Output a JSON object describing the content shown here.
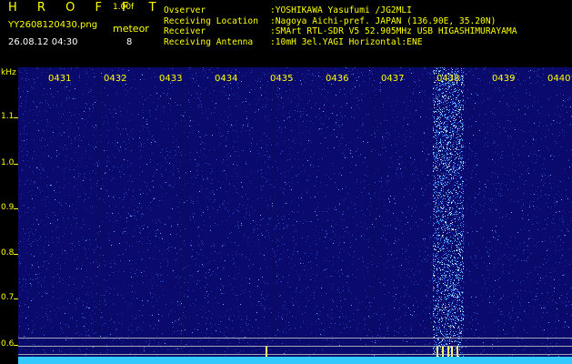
{
  "header": {
    "brand": "H R O F F T",
    "version": "1.00f",
    "filename": "YY2608120430.png",
    "meteor_label": "meteor",
    "datetime": "26.08.12 04:30",
    "meteor_count": "8"
  },
  "info": [
    {
      "label": "Ovserver",
      "value": ":YOSHIKAWA Yasufumi /JG2MLI"
    },
    {
      "label": "Receiving Location",
      "value": ":Nagoya Aichi-pref. JAPAN (136.90E, 35.20N)"
    },
    {
      "label": "Receiver",
      "value": ":SMArt RTL-SDR V5 52.905MHz USB HIGASHIMURAYAMA"
    },
    {
      "label": "Receiving Antenna",
      "value": ":10mH 3el.YAGI Horizontal:ENE"
    }
  ],
  "plot": {
    "y_unit": "kHz",
    "y_ticks": [
      "1.1",
      "1.0",
      "0.9",
      "0.8",
      "0.7",
      "0.6"
    ],
    "x_ticks": [
      "0431",
      "0432",
      "0433",
      "0434",
      "0435",
      "0436",
      "0437",
      "0438",
      "0439",
      "0440"
    ],
    "colors": {
      "label": "#ffff00",
      "background": "#0a0a6c",
      "signal": "#32c9ff"
    }
  }
}
